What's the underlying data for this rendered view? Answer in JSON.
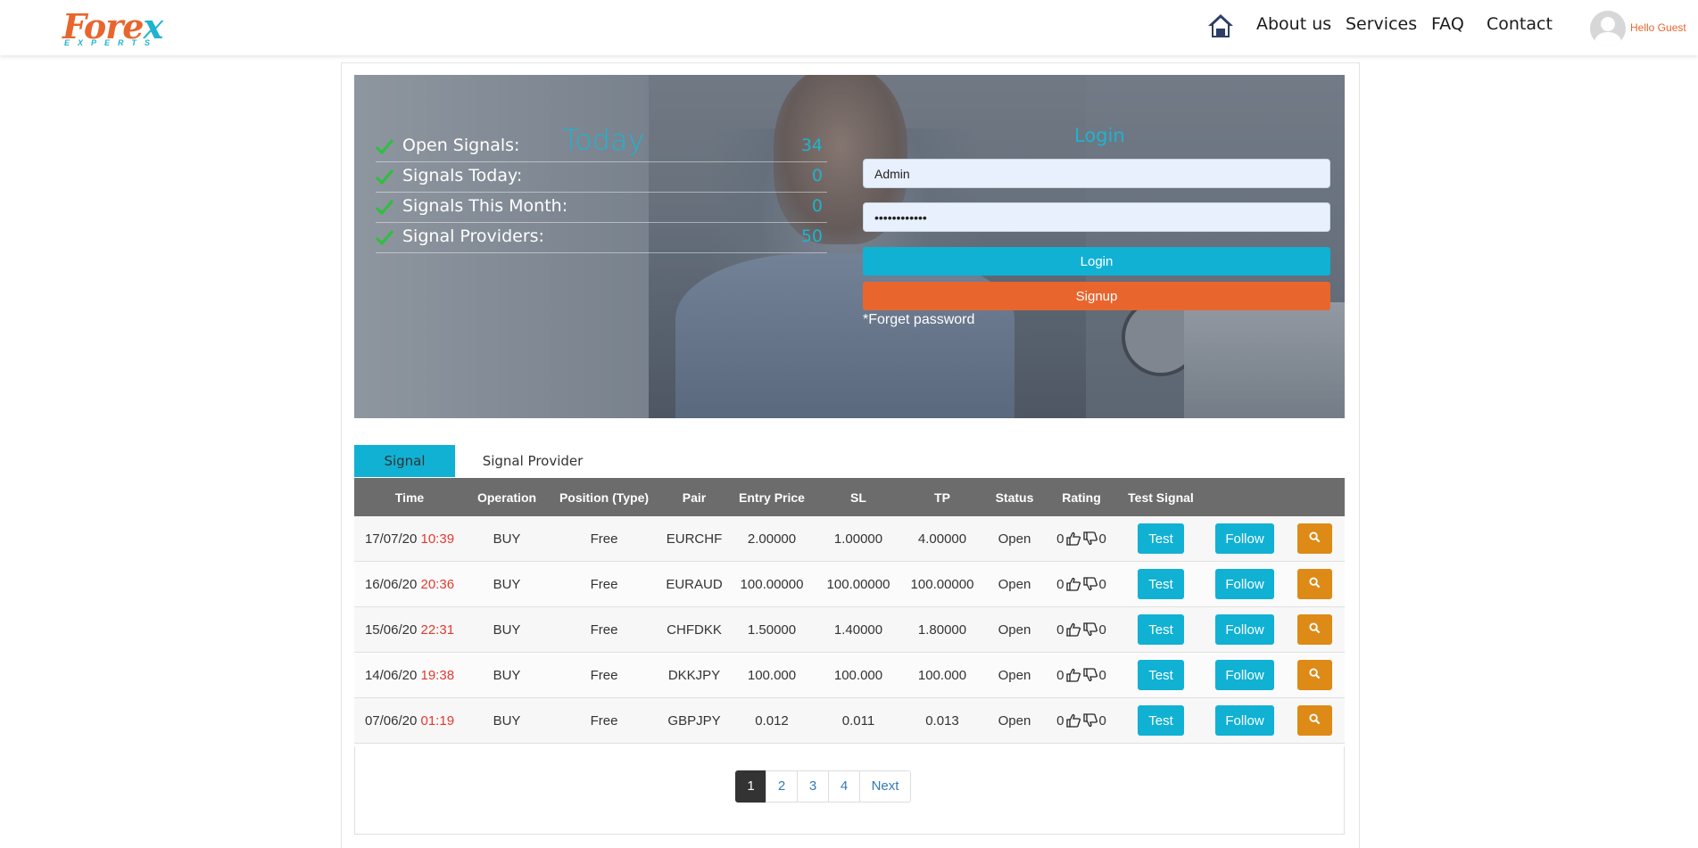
{
  "brand": {
    "logo_part1": "Fore",
    "logo_part2": "x",
    "logo_sub": "EXPERTS"
  },
  "nav": {
    "home_icon": "home-icon",
    "items": [
      "About us",
      "Services",
      "FAQ",
      "Contact"
    ],
    "greeting": "Hello Guest"
  },
  "stats": {
    "title": "Today",
    "rows": [
      {
        "label": "Open Signals:",
        "value": "34"
      },
      {
        "label": "Signals Today:",
        "value": "0"
      },
      {
        "label": "Signals This Month:",
        "value": "0"
      },
      {
        "label": "Signal Providers:",
        "value": "50"
      }
    ]
  },
  "login": {
    "title": "Login",
    "username_value": "Admin",
    "password_value": "••••••••••••",
    "login_label": "Login",
    "signup_label": "Signup",
    "forget_label": "*Forget password"
  },
  "tabs": [
    "Signal",
    "Signal Provider"
  ],
  "table": {
    "headers": [
      "Time",
      "Operation",
      "Position (Type)",
      "Pair",
      "Entry Price",
      "SL",
      "TP",
      "Status",
      "Rating",
      "Test Signal",
      "",
      ""
    ],
    "rows": [
      {
        "date": "17/07/20",
        "hm": "10:39",
        "operation": "BUY",
        "position": "Free",
        "pair": "EURCHF",
        "entry": "2.00000",
        "sl": "1.00000",
        "tp": "4.00000",
        "status": "Open",
        "up": "0",
        "down": "0"
      },
      {
        "date": "16/06/20",
        "hm": "20:36",
        "operation": "BUY",
        "position": "Free",
        "pair": "EURAUD",
        "entry": "100.00000",
        "sl": "100.00000",
        "tp": "100.00000",
        "status": "Open",
        "up": "0",
        "down": "0"
      },
      {
        "date": "15/06/20",
        "hm": "22:31",
        "operation": "BUY",
        "position": "Free",
        "pair": "CHFDKK",
        "entry": "1.50000",
        "sl": "1.40000",
        "tp": "1.80000",
        "status": "Open",
        "up": "0",
        "down": "0"
      },
      {
        "date": "14/06/20",
        "hm": "19:38",
        "operation": "BUY",
        "position": "Free",
        "pair": "DKKJPY",
        "entry": "100.000",
        "sl": "100.000",
        "tp": "100.000",
        "status": "Open",
        "up": "0",
        "down": "0"
      },
      {
        "date": "07/06/20",
        "hm": "01:19",
        "operation": "BUY",
        "position": "Free",
        "pair": "GBPJPY",
        "entry": "0.012",
        "sl": "0.011",
        "tp": "0.013",
        "status": "Open",
        "up": "0",
        "down": "0"
      }
    ],
    "test_label": "Test",
    "follow_label": "Follow",
    "search_icon": "search-icon"
  },
  "pagination": {
    "pages": [
      "1",
      "2",
      "3",
      "4"
    ],
    "current": "1",
    "next_label": "Next"
  },
  "colors": {
    "accent_cyan": "#11b1d3",
    "accent_orange": "#e8662e",
    "search_orange": "#dd8a17",
    "header_gray": "#6d6c6c",
    "time_red": "#e03a2f"
  }
}
